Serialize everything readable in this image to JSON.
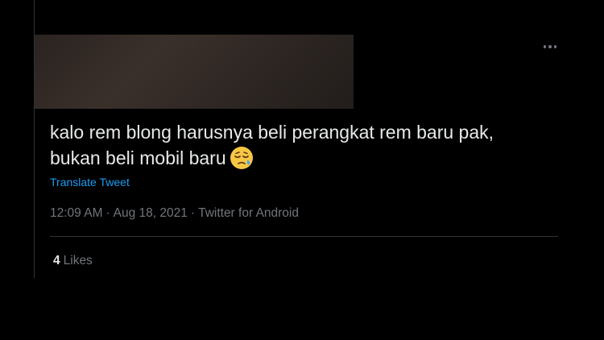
{
  "tweet": {
    "text_line_1": "kalo rem blong harusnya beli perangkat rem baru pak,",
    "text_line_2": "bukan beli mobil baru",
    "emoji_icon": "sad-relieved-face-emoji-icon",
    "translate_label": "Translate Tweet",
    "time": "12:09 AM",
    "date": "Aug 18, 2021",
    "separator": "·",
    "source": "Twitter for Android",
    "likes_count": "4",
    "likes_label": "Likes",
    "more_icon": "more-horizontal-icon"
  },
  "colors": {
    "background": "#000000",
    "text": "#e7e9ea",
    "muted": "#71767b",
    "link": "#1d9bf0",
    "border": "#2f3336"
  }
}
